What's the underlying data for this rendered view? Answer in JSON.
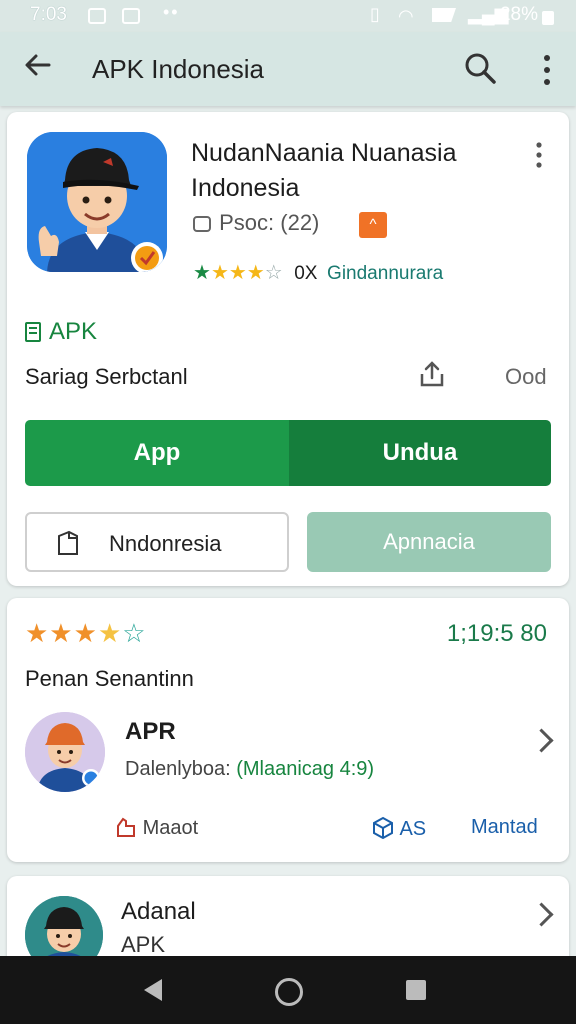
{
  "status_bar": {
    "time": "7:03",
    "battery_text": "28%"
  },
  "app_bar": {
    "title": "APK Indonesia",
    "icons": [
      "back-arrow-icon",
      "search-icon",
      "more-vert-icon"
    ]
  },
  "app_card": {
    "name": "NudanNaania Nuanasia Indonesia",
    "meta": "Psoc: (22)",
    "rating_count": "0X",
    "developer": "Gindannurara",
    "rating_stars": 3.5,
    "apk_label": "APK",
    "subtitle": "Sariag Serbctanl",
    "size_text": "Ood",
    "primary_left_label": "App",
    "primary_right_label": "Undua",
    "outline_button_label": "Nndonresia",
    "soft_button_label": "Apnnacia",
    "colors": {
      "primary_green": "#1c9a4a",
      "primary_green_dark": "#157e3c",
      "soft_green": "#99c9b4",
      "badge_orange": "#f07226"
    }
  },
  "review_card": {
    "stars": 3.5,
    "count_text": "1;19:5 80",
    "title": "Penan Senantinn",
    "item_name": "APR",
    "developer_prefix": "Dalenlyboa:",
    "developer_highlight": "(Mlaanicag 4:9)",
    "action_report": "Maaot",
    "action_as": "AS",
    "action_manted": "Mantad"
  },
  "list_card": {
    "name": "Adanal",
    "sub": "APK"
  }
}
